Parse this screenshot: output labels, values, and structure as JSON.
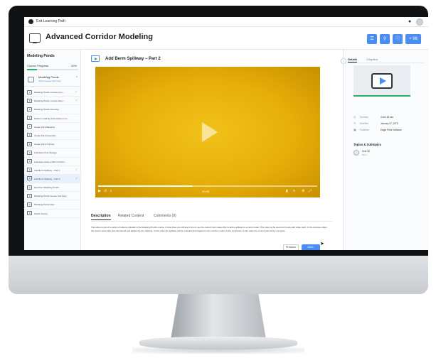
{
  "system_bar": {
    "exit_label": "Exit Learning Path"
  },
  "header": {
    "title": "Advanced Corridor Modeling",
    "last_button_label": "+ 96"
  },
  "sidebar": {
    "heading": "Modeling Ponds",
    "progress_label": "Course Progress",
    "progress_value": "20%",
    "progress_fraction": 0.2,
    "group": {
      "name": "Modeling Ponds",
      "subtitle": "Show Course Summary"
    },
    "items": [
      {
        "label": "Modeling Ponds: Course Intro...",
        "completed": true,
        "active": false
      },
      {
        "label": "Modeling Ponds: Course Struc...",
        "completed": true,
        "active": false
      },
      {
        "label": "Modeling Ponds Overview",
        "completed": false,
        "active": false
      },
      {
        "label": "Perform Grading Optimization in G...",
        "completed": false,
        "active": false
      },
      {
        "label": "Create Pond Baseline",
        "completed": false,
        "active": false
      },
      {
        "label": "Create Pond Assembly",
        "completed": false,
        "active": false
      },
      {
        "label": "Create Pond Corridor",
        "completed": false,
        "active": false
      },
      {
        "label": "Calculate Pond Storage",
        "completed": false,
        "active": false
      },
      {
        "label": "Calculate Outlet to Berm Increm...",
        "completed": false,
        "active": false
      },
      {
        "label": "Add Berm Spillway – Part 1",
        "completed": true,
        "active": false
      },
      {
        "label": "Add Berm Spillway – Part 2",
        "completed": true,
        "active": true
      },
      {
        "label": "Exercise: Modeling Ponds",
        "completed": false,
        "active": false
      },
      {
        "label": "Modeling Ponds Course Summary",
        "completed": false,
        "active": false
      },
      {
        "label": "Modeling Ponds Quiz",
        "completed": false,
        "active": false
      },
      {
        "label": "Finish Course",
        "completed": false,
        "active": false
      }
    ]
  },
  "main": {
    "video_title": "Add Berm Spillway – Part 2",
    "player": {
      "progress_fraction": 0.43,
      "time_text": "00:48"
    },
    "tabs": [
      {
        "label": "Description",
        "active": true
      },
      {
        "label": "Related Content",
        "active": false
      },
      {
        "label": "Comments (0)",
        "active": false
      }
    ],
    "description": "This video is part of a series of videos included in the Modeling Ponds course. In this video you will learn how to use the custom berm assembly to add a spillway to a pond model. This video is the second of a two-part video topic. In the previous video the custom assembly was introduced and added into the drawing. In this video the spillway will be modeled and targeted in the corridor model. At the conclusion of this video the pond model will be complete.",
    "previous_label": "Previous",
    "next_label": "Next"
  },
  "right_panel": {
    "tabs": [
      {
        "label": "Details",
        "active": true
      },
      {
        "label": "Chapters",
        "active": false
      }
    ],
    "meta": [
      {
        "key": "Duration",
        "value": "4 min 48 sec",
        "icon": "clock-icon"
      },
      {
        "key": "Modified",
        "value": "January 07, 1970",
        "icon": "pencil-icon"
      },
      {
        "key": "Publisher",
        "value": "Eagle Point Software",
        "icon": "building-icon"
      }
    ],
    "topics_heading": "Topics & Subtopics",
    "unit": {
      "name": "Unit 30",
      "sub": "Berm"
    }
  }
}
